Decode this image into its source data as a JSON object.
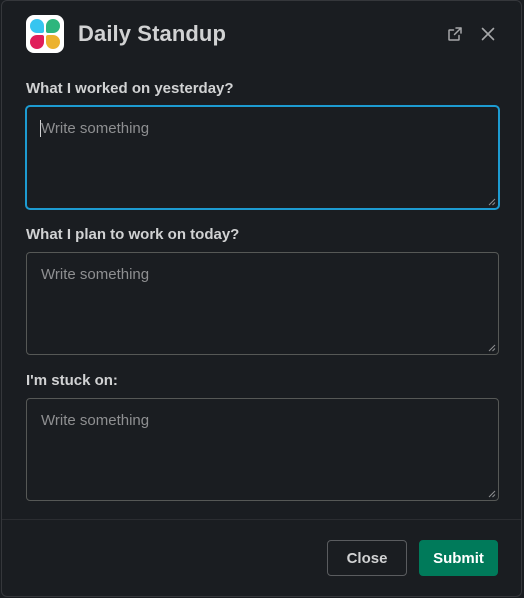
{
  "modal": {
    "title": "Daily Standup",
    "app_icon": "slack-app-icon",
    "popout_icon": "external-link-icon",
    "close_icon": "close-icon"
  },
  "fields": [
    {
      "label": "What I worked on yesterday?",
      "placeholder": "Write something",
      "value": "",
      "focused": true
    },
    {
      "label": "What I plan to work on today?",
      "placeholder": "Write something",
      "value": "",
      "focused": false
    },
    {
      "label": "I'm stuck on:",
      "placeholder": "Write something",
      "value": "",
      "focused": false
    }
  ],
  "footer": {
    "close_label": "Close",
    "submit_label": "Submit"
  },
  "colors": {
    "background": "#1a1d21",
    "focus_ring": "#1d9bd1",
    "submit": "#007a5a",
    "text": "#d1d2d3",
    "placeholder": "#8e8f91"
  }
}
